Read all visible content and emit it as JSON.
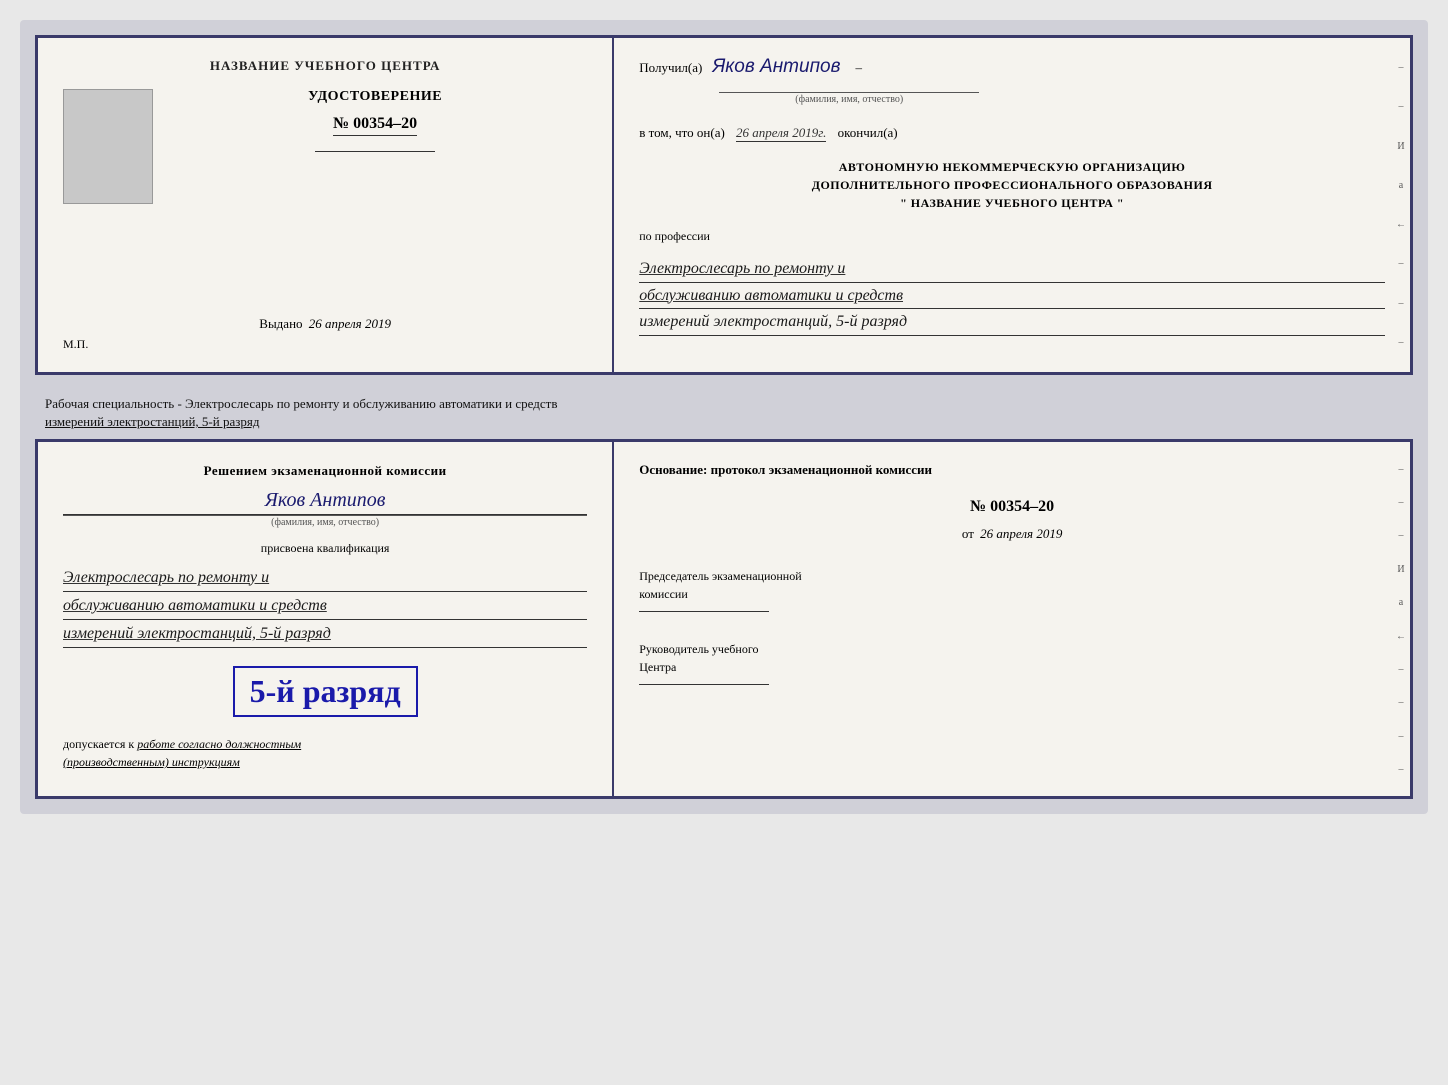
{
  "top_doc": {
    "left": {
      "center_title": "НАЗВАНИЕ УЧЕБНОГО ЦЕНТРА",
      "photo_alt": "photo placeholder",
      "udostoverenie": "УДОСТОВЕРЕНИЕ",
      "number": "№ 00354–20",
      "vydano_label": "Выдано",
      "vydano_date": "26 апреля 2019",
      "mp": "М.П."
    },
    "right": {
      "poluchil_label": "Получил(а)",
      "recipient_name": "Яков Антипов",
      "fio_subtitle": "(фамилия, имя, отчество)",
      "vtom_label": "в том, что он(а)",
      "vtom_date": "26 апреля 2019г.",
      "okonchil": "окончил(а)",
      "org_line1": "АВТОНОМНУЮ НЕКОММЕРЧЕСКУЮ ОРГАНИЗАЦИЮ",
      "org_line2": "ДОПОЛНИТЕЛЬНОГО ПРОФЕССИОНАЛЬНОГО ОБРАЗОВАНИЯ",
      "org_name": "\" НАЗВАНИЕ УЧЕБНОГО ЦЕНТРА \"",
      "po_professii": "по профессии",
      "profession_line1": "Электрослесарь по ремонту и",
      "profession_line2": "обслуживанию автоматики и средств",
      "profession_line3": "измерений электростанций, 5-й разряд",
      "side_marks": [
        "–",
        "–",
        "И",
        "а",
        "←",
        "–",
        "–",
        "–"
      ]
    }
  },
  "separator": {
    "text": "Рабочая специальность - Электрослесарь по ремонту и обслуживанию автоматики и средств",
    "text2": "измерений электростанций, 5-й разряд"
  },
  "bottom_doc": {
    "left": {
      "resheniem": "Решением экзаменационной комиссии",
      "person_name": "Яков Антипов",
      "fio_subtitle": "(фамилия, имя, отчество)",
      "prisvoena": "присвоена квалификация",
      "qual_line1": "Электрослесарь по ремонту и",
      "qual_line2": "обслуживанию автоматики и средств",
      "qual_line3": "измерений электростанций, 5-й разряд",
      "razryad_big": "5-й разряд",
      "dopuskaetsya": "допускается к",
      "dopusk_italic": "работе согласно должностным",
      "dopusk_italic2": "(производственным) инструкциям"
    },
    "right": {
      "osnovanie": "Основание: протокол экзаменационной комиссии",
      "protocol_number": "№ 00354–20",
      "ot_label": "от",
      "ot_date": "26 апреля 2019",
      "predsedatel_line1": "Председатель экзаменационной",
      "predsedatel_line2": "комиссии",
      "rukovoditel_line1": "Руководитель учебного",
      "rukovoditel_line2": "Центра",
      "side_marks": [
        "–",
        "–",
        "–",
        "И",
        "а",
        "←",
        "–",
        "–",
        "–",
        "–"
      ]
    }
  }
}
